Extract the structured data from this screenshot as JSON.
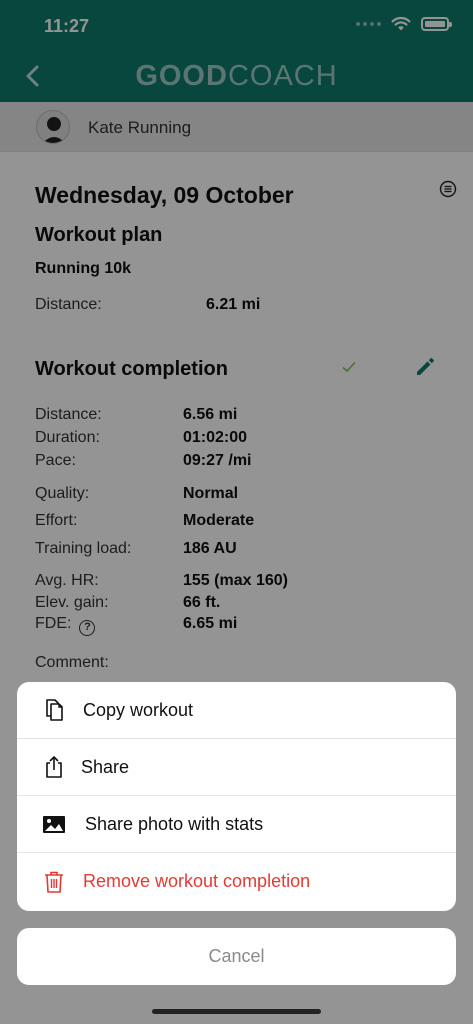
{
  "status": {
    "time": "11:27"
  },
  "header": {
    "logo_bold": "GOOD",
    "logo_light": "COACH"
  },
  "user": {
    "name": "Kate Running"
  },
  "day": {
    "date": "Wednesday, 09 October"
  },
  "plan": {
    "title": "Workout plan",
    "name": "Running 10k",
    "distance_label": "Distance:",
    "distance_value": "6.21 mi"
  },
  "completion": {
    "title": "Workout completion",
    "distance_label": "Distance:",
    "distance_value": "6.56 mi",
    "duration_label": "Duration:",
    "duration_value": "01:02:00",
    "pace_label": "Pace:",
    "pace_value": "09:27 /mi",
    "quality_label": "Quality:",
    "quality_value": "Normal",
    "effort_label": "Effort:",
    "effort_value": "Moderate",
    "load_label": "Training load:",
    "load_value": "186 AU",
    "hr_label": "Avg. HR:",
    "hr_value": "155 (max 160)",
    "elev_label": "Elev. gain:",
    "elev_value": "66 ft.",
    "fde_label": "FDE:",
    "fde_value": "6.65 mi",
    "comment_label": "Comment:"
  },
  "action_sheet": {
    "items": [
      {
        "label": "Copy workout",
        "icon": "copy-icon"
      },
      {
        "label": "Share",
        "icon": "share-icon"
      },
      {
        "label": "Share photo with stats",
        "icon": "image-icon"
      },
      {
        "label": "Remove workout completion",
        "icon": "trash-icon"
      }
    ],
    "cancel": "Cancel"
  },
  "colors": {
    "brand": "#0e7a6c",
    "danger": "#e53935",
    "check": "#8bc34a"
  }
}
